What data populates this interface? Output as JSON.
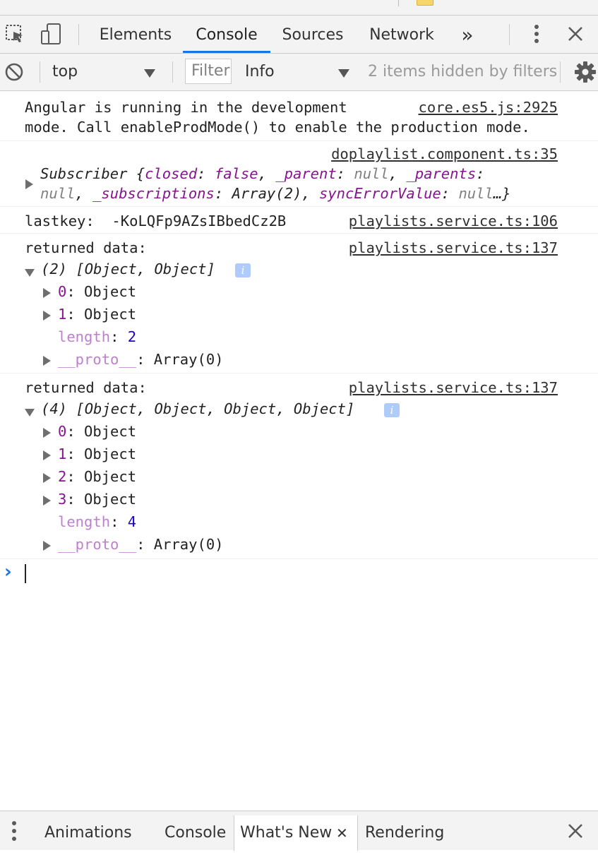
{
  "toolbar": {
    "tabs": [
      {
        "label": "Elements"
      },
      {
        "label": "Console"
      },
      {
        "label": "Sources"
      },
      {
        "label": "Network"
      }
    ],
    "overflow_label": "»"
  },
  "filterbar": {
    "context": "top",
    "filter_placeholder": "Filter",
    "level": "Info",
    "hidden_status": "2 items hidden by filters"
  },
  "console": {
    "messages": [
      {
        "line1": "Angular is running in the development",
        "line2": "mode. Call enableProdMode() to enable the production mode.",
        "source": "core.es5.js:2925"
      },
      {
        "source": "doplaylist.component.ts:35",
        "line1": "Subscriber {closed: false, _parent: null, _parents:",
        "line2": "null, _subscriptions: Array(2), syncErrorValue: null…}"
      },
      {
        "text": "lastkey:  -KoLQFp9AZsIBbedCz2B",
        "source": "playlists.service.ts:106"
      },
      {
        "text": "returned data:",
        "source": "playlists.service.ts:137",
        "summary": "(2) [Object, Object]",
        "items": [
          {
            "index": "0",
            "value": "Object"
          },
          {
            "index": "1",
            "value": "Object"
          }
        ],
        "length_key": "length",
        "length_value": "2",
        "proto_key": "__proto__",
        "proto_value": "Array(0)"
      },
      {
        "text": "returned data:",
        "source": "playlists.service.ts:137",
        "summary": "(4) [Object, Object, Object, Object]",
        "items": [
          {
            "index": "0",
            "value": "Object"
          },
          {
            "index": "1",
            "value": "Object"
          },
          {
            "index": "2",
            "value": "Object"
          },
          {
            "index": "3",
            "value": "Object"
          }
        ],
        "length_key": "length",
        "length_value": "4",
        "proto_key": "__proto__",
        "proto_value": "Array(0)"
      }
    ],
    "prompt_symbol": "›"
  },
  "drawer": {
    "tabs": [
      {
        "label": "Animations"
      },
      {
        "label": "Console"
      },
      {
        "label": "What's New"
      },
      {
        "label": "Rendering"
      }
    ],
    "tab_close_symbol": "✕"
  },
  "colors": {
    "accent": "#1a73e8",
    "toolbar_bg": "#f3f3f3",
    "object_key": "#881391",
    "number": "#1c00cf"
  }
}
